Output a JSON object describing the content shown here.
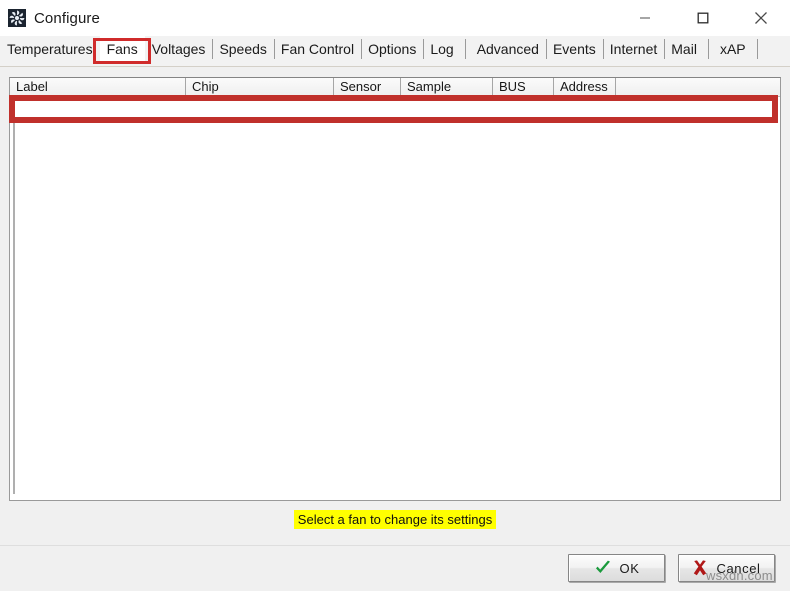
{
  "window": {
    "title": "Configure",
    "icon": "fan-icon",
    "controls": {
      "minimize": "minimize-icon",
      "maximize": "maximize-icon",
      "close": "close-icon"
    }
  },
  "tabs": {
    "selected": "Fans",
    "items": [
      {
        "label": "Temperatures"
      },
      {
        "label": "Fans"
      },
      {
        "label": "Voltages"
      },
      {
        "label": "Speeds"
      },
      {
        "label": "Fan Control"
      },
      {
        "label": "Options"
      },
      {
        "label": "Log"
      },
      {
        "label": "Advanced"
      },
      {
        "label": "Events"
      },
      {
        "label": "Internet"
      },
      {
        "label": "Mail"
      },
      {
        "label": "xAP"
      }
    ]
  },
  "list": {
    "columns": [
      {
        "label": "Label"
      },
      {
        "label": "Chip"
      },
      {
        "label": "Sensor"
      },
      {
        "label": "Sample"
      },
      {
        "label": "BUS"
      },
      {
        "label": "Address"
      }
    ],
    "rows": []
  },
  "annotations": {
    "tab_highlight_color": "#d02b2b",
    "row_highlight_color": "#c0302b"
  },
  "hint": {
    "text": "Select a fan to change its settings",
    "background": "#ffff00"
  },
  "footer": {
    "ok_label": "OK",
    "cancel_label": "Cancel",
    "ok_icon": "checkmark-icon",
    "cancel_icon": "cross-icon"
  },
  "watermark": {
    "text": "wsxdn.com"
  }
}
